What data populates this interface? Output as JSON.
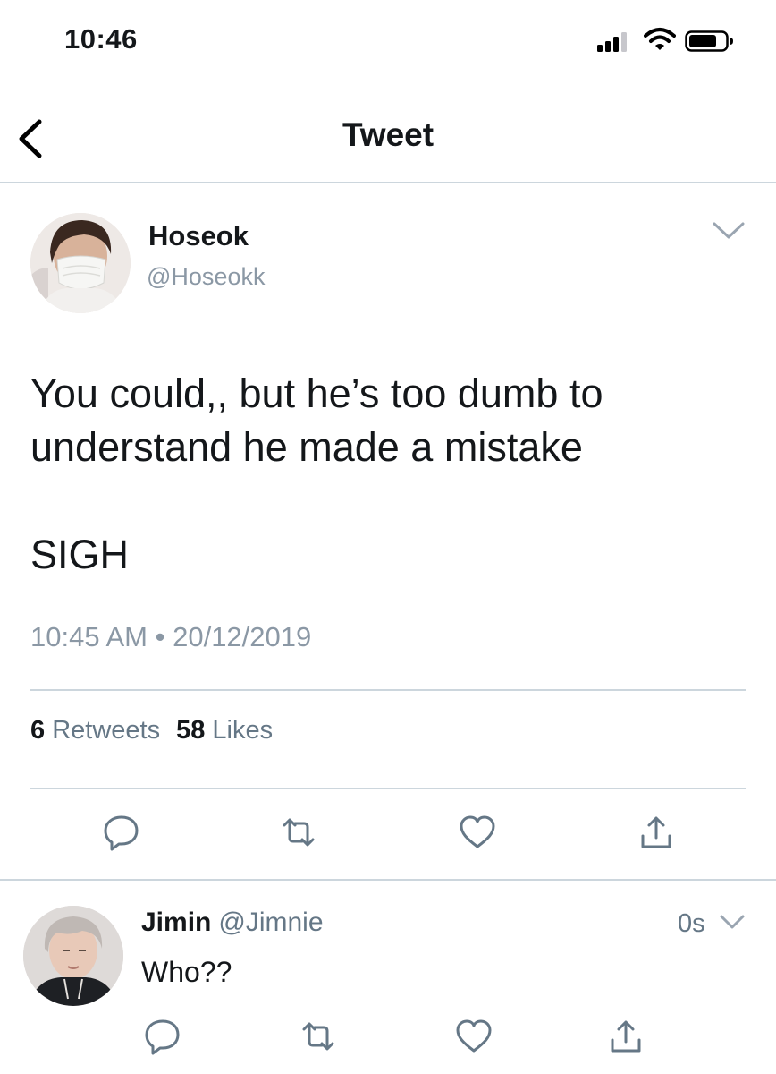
{
  "status_bar": {
    "time": "10:46"
  },
  "nav": {
    "title": "Tweet"
  },
  "tweet": {
    "name": "Hoseok",
    "handle": "@Hoseokk",
    "text_line1": "You could,, but he’s too dumb to understand he made a mistake",
    "text_line2": "SIGH",
    "time": "10:45 AM",
    "separator": "•",
    "date": "20/12/2019",
    "retweets_count": "6",
    "retweets_label": "Retweets",
    "likes_count": "58",
    "likes_label": "Likes"
  },
  "reply": {
    "name": "Jimin",
    "handle": "@Jimnie",
    "time": "0s",
    "text": "Who??"
  },
  "colors": {
    "icon_gray": "#657786",
    "secondary_text": "#8b98a5",
    "divider": "#ccd6dd"
  },
  "icons": [
    "back-icon",
    "chevron-down-icon",
    "reply-icon",
    "retweet-icon",
    "like-icon",
    "share-icon",
    "signal-icon",
    "wifi-icon",
    "battery-icon"
  ]
}
